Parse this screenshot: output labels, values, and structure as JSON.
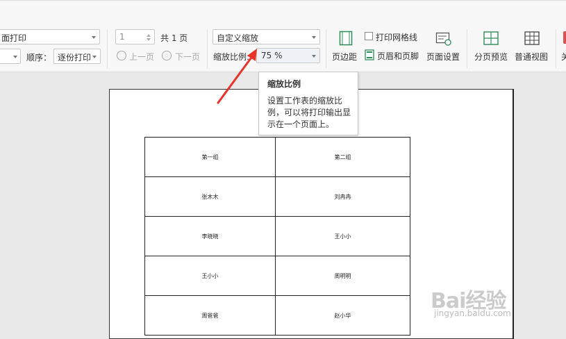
{
  "toolbar": {
    "print_mode": "面打印",
    "page_from": "1",
    "total_pages": "共 1 页",
    "order_label": "顺序：",
    "order_value": "逐份打印",
    "prev_page": "上一页",
    "next_page": "下一页",
    "scale_mode": "自定义缩放",
    "scale_label": "缩放比例:",
    "scale_value": "75 %",
    "print_gridlines": "打印网格线",
    "margins": "页边距",
    "header_footer": "页眉和页脚",
    "page_setup": "页面设置",
    "page_break_preview": "分页预览",
    "normal_view": "普通视图",
    "close_partial": "关"
  },
  "tooltip": {
    "title": "缩放比例",
    "body": "设置工作表的缩放比例，可以将打印输出显示在一个页面上。"
  },
  "sheet": {
    "rows": [
      [
        "第一组",
        "第二组"
      ],
      [
        "张木木",
        "刘冉冉"
      ],
      [
        "李晓晓",
        "王小小"
      ],
      [
        "王小小",
        "周明明"
      ],
      [
        "周爸爸",
        "赵小华"
      ]
    ]
  },
  "watermark": {
    "text": "Bai经验",
    "sub": "jingyan.baidu.com"
  },
  "colors": {
    "arrow": "#e8322a",
    "close_accent": "#d9534f"
  }
}
